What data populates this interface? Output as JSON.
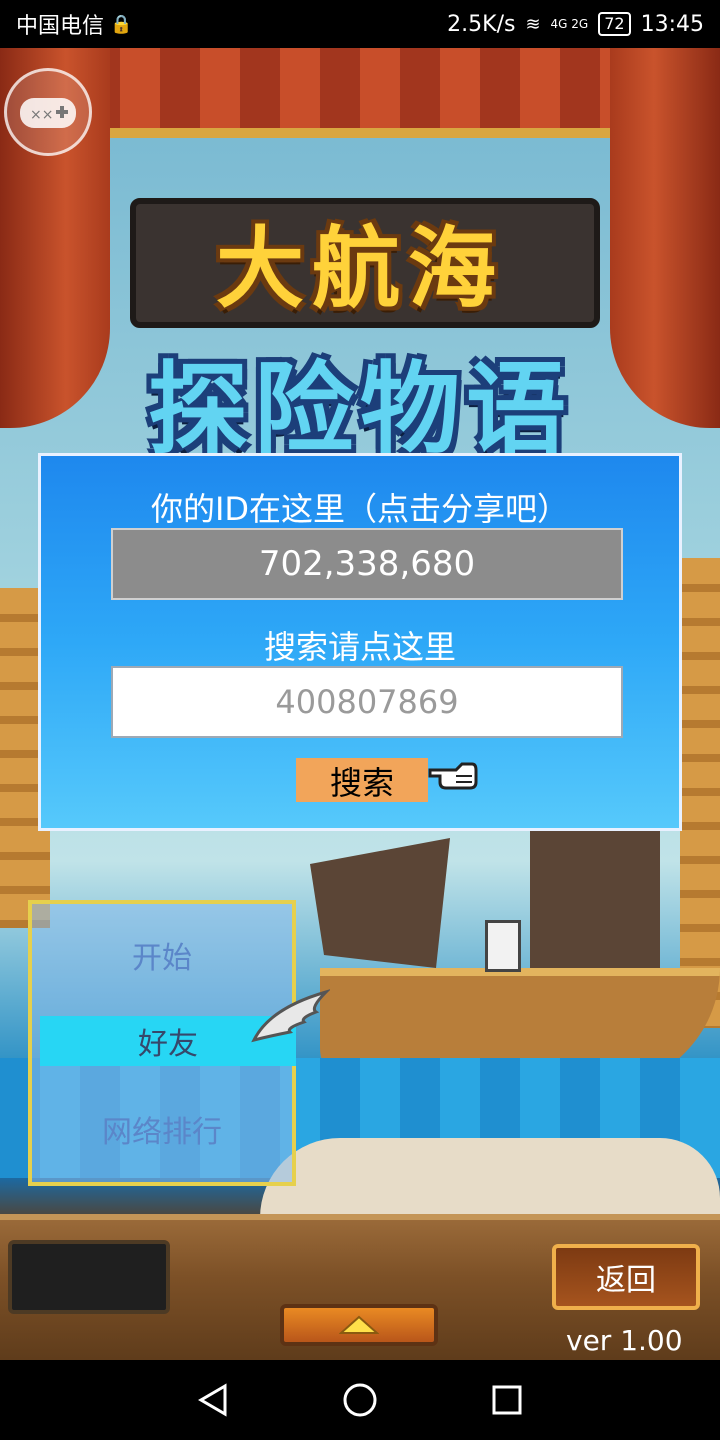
{
  "status_bar": {
    "carrier": "中国电信",
    "speed": "2.5K/s",
    "network": "4G 2G",
    "battery": "72",
    "time": "13:45"
  },
  "logo": {
    "line1": "大航海",
    "line2": "探险物语"
  },
  "id_panel": {
    "title": "你的ID在这里（点击分享吧）",
    "id_value": "702,338,680",
    "search_label": "搜索请点这里",
    "search_placeholder": "400807869",
    "search_button": "搜索"
  },
  "menu": {
    "items": [
      {
        "label": "开始"
      },
      {
        "label": "好友"
      },
      {
        "label": "网络排行"
      }
    ]
  },
  "bottom": {
    "back_label": "返回",
    "version": "ver 1.00"
  },
  "icons": {
    "gamepad": "gamepad-icon",
    "pointer": "pointing-hand-icon",
    "wing": "wing-cursor-icon",
    "up": "up-arrow-icon",
    "nav_back": "triangle-back-icon",
    "nav_home": "circle-home-icon",
    "nav_recent": "square-recent-icon"
  },
  "colors": {
    "panel_blue": "#2ea8f7",
    "menu_highlight": "#27d6f4",
    "button_orange": "#f2a55a",
    "logo_yellow": "#ffd23a",
    "logo_cyan": "#62d4f2"
  }
}
